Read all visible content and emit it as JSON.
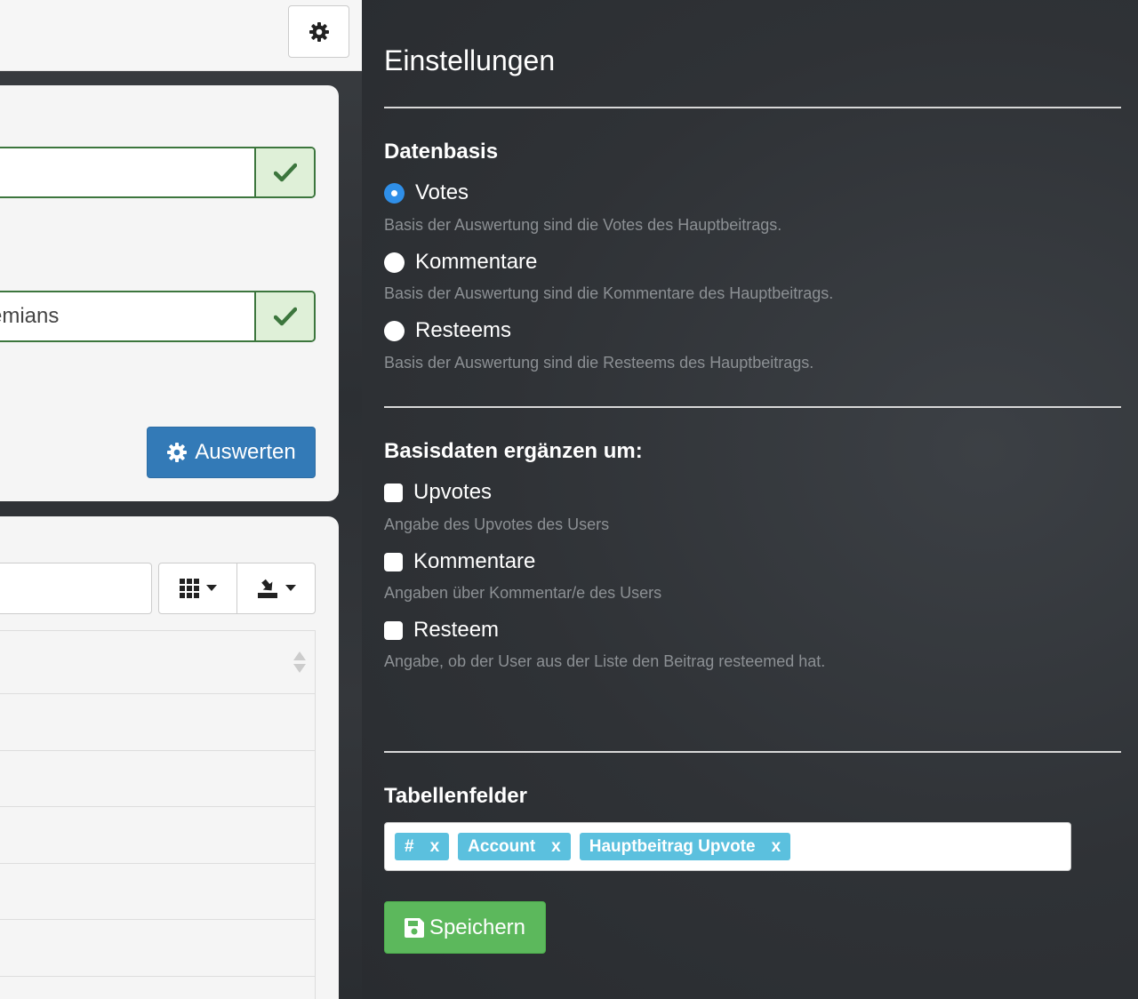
{
  "topbar": {
    "settings_icon": "gear-icon"
  },
  "form": {
    "field1": {
      "value": "",
      "status_icon": "check-icon"
    },
    "field2": {
      "value": "emians",
      "status_icon": "check-icon"
    },
    "submit_label": "Auswerten"
  },
  "table_toolbar": {
    "columns_icon": "grid-icon",
    "export_icon": "download-icon",
    "search_value": ""
  },
  "settings": {
    "title": "Einstellungen",
    "datenbasis": {
      "heading": "Datenbasis",
      "options": [
        {
          "label": "Votes",
          "help": "Basis der Auswertung sind die Votes des Hauptbeitrags.",
          "selected": true
        },
        {
          "label": "Kommentare",
          "help": "Basis der Auswertung sind die Kommentare des Hauptbeitrags.",
          "selected": false
        },
        {
          "label": "Resteems",
          "help": "Basis der Auswertung sind die Resteems des Hauptbeitrags.",
          "selected": false
        }
      ]
    },
    "basisdaten": {
      "heading": "Basisdaten ergänzen um:",
      "options": [
        {
          "label": "Upvotes",
          "help": "Angabe des Upvotes des Users",
          "checked": false
        },
        {
          "label": "Kommentare",
          "help": "Angaben über Kommentar/e des Users",
          "checked": false
        },
        {
          "label": "Resteem",
          "help": "Angabe, ob der User aus der Liste den Beitrag resteemed hat.",
          "checked": false
        }
      ]
    },
    "tabellenfelder": {
      "heading": "Tabellenfelder",
      "tags": [
        {
          "label": "#",
          "remove": "x"
        },
        {
          "label": "Account",
          "remove": "x"
        },
        {
          "label": "Hauptbeitrag Upvote",
          "remove": "x"
        }
      ]
    },
    "save_label": "Speichern"
  },
  "colors": {
    "primary": "#337ab7",
    "success": "#5cb85c",
    "info": "#5bc0de",
    "valid": "#3c763d",
    "radio_active": "#2f8fe8"
  }
}
